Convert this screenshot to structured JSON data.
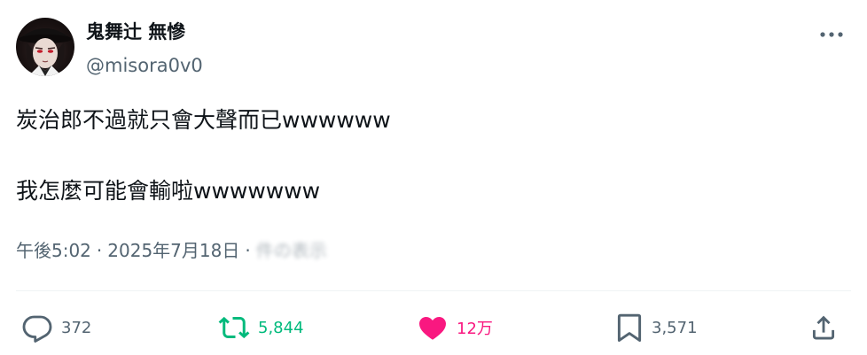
{
  "author": {
    "display_name": "鬼舞辻 無慘",
    "handle": "@misora0v0"
  },
  "icons": {
    "more": "more-horizontal-icon",
    "reply": "reply-icon",
    "retweet": "retweet-icon",
    "like": "heart-filled-icon",
    "bookmark": "bookmark-icon",
    "share": "share-icon"
  },
  "tweet": {
    "lines": [
      "炭治郎不過就只會大聲而已wwwwww",
      "我怎麼可能會輸啦wwwwwww"
    ],
    "time": "午後5:02",
    "separator": "·",
    "date": "2025年7月18日",
    "views": "件の表示"
  },
  "stats": {
    "replies": "372",
    "retweets": "5,844",
    "likes": "12万",
    "bookmarks": "3,571"
  },
  "colors": {
    "text": "#0f1419",
    "secondary": "#536471",
    "retweet_active": "#00ba7c",
    "like_active": "#f91880",
    "divider": "#eff3f4"
  }
}
